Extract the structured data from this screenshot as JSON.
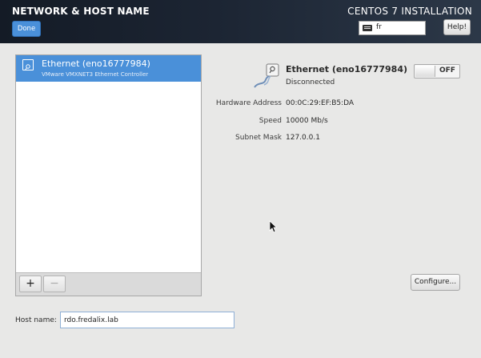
{
  "header": {
    "title": "NETWORK & HOST NAME",
    "done_label": "Done",
    "install_title": "CENTOS 7 INSTALLATION",
    "keyboard_layout": "fr",
    "help_label": "Help!"
  },
  "device_list": {
    "items": [
      {
        "name": "Ethernet (eno16777984)",
        "description": "VMware VMXNET3 Ethernet Controller",
        "selected": true
      }
    ],
    "add_label": "+",
    "remove_label": "−"
  },
  "device": {
    "name": "Ethernet (eno16777984)",
    "status": "Disconnected",
    "toggle_label": "OFF",
    "properties": [
      {
        "label": "Hardware Address",
        "value": "00:0C:29:EF:B5:DA"
      },
      {
        "label": "Speed",
        "value": "10000 Mb/s"
      },
      {
        "label": "Subnet Mask",
        "value": "127.0.0.1"
      }
    ],
    "configure_label": "Configure..."
  },
  "hostname": {
    "label": "Host name:",
    "value": "rdo.fredalix.lab"
  },
  "colors": {
    "accent": "#4a90d9",
    "header_bg": "#1c2533",
    "body_bg": "#e8e8e7"
  },
  "icons": [
    "keyboard-icon",
    "ethernet-icon",
    "mouse-cursor-icon"
  ]
}
